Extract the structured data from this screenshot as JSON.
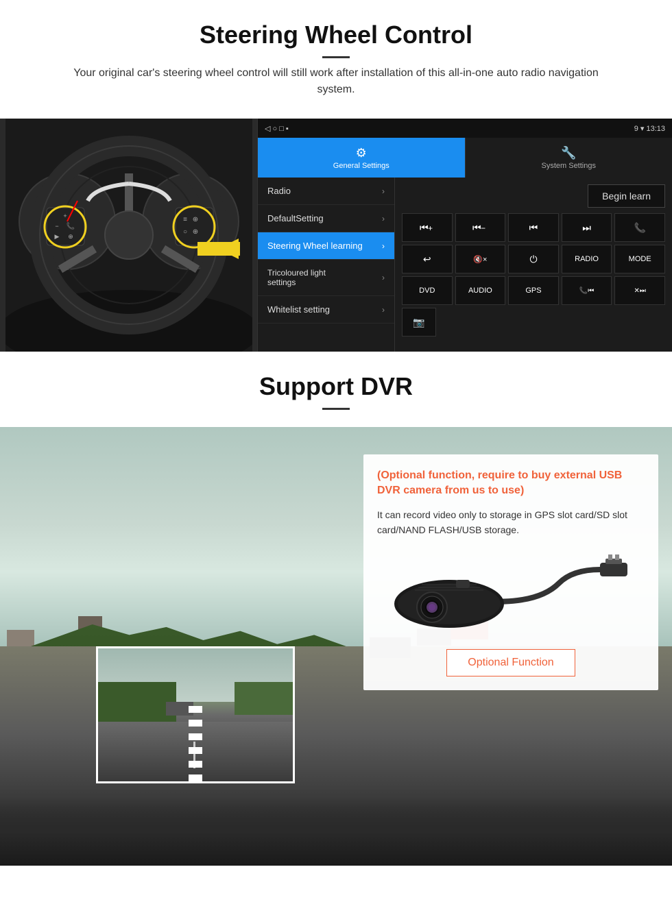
{
  "page": {
    "section1": {
      "title": "Steering Wheel Control",
      "subtitle": "Your original car's steering wheel control will still work after installation of this all-in-one auto radio navigation system.",
      "divider": "—"
    },
    "android_ui": {
      "status_bar": {
        "left_icons": "◁  ○  □  ▪",
        "right_text": "9 ▾ 13:13"
      },
      "tab_general": {
        "icon": "⚙",
        "label": "General Settings"
      },
      "tab_system": {
        "icon": "🔧",
        "label": "System Settings"
      },
      "menu_items": [
        {
          "label": "Radio",
          "active": false
        },
        {
          "label": "DefaultSetting",
          "active": false
        },
        {
          "label": "Steering Wheel learning",
          "active": true
        },
        {
          "label": "Tricoloured light settings",
          "active": false
        },
        {
          "label": "Whitelist setting",
          "active": false
        }
      ],
      "begin_learn": "Begin learn",
      "control_buttons": {
        "row1": [
          "⏮+",
          "⏮−",
          "⏮⏮",
          "⏭⏭",
          "📞"
        ],
        "row2": [
          "↩",
          "🔇×",
          "⏻",
          "RADIO",
          "MODE"
        ],
        "row3": [
          "DVD",
          "AUDIO",
          "GPS",
          "📞⏮",
          "✕⏭"
        ],
        "row4": [
          "📷"
        ]
      }
    },
    "section2": {
      "title": "Support DVR",
      "divider": "—",
      "optional_note": "(Optional function, require to buy external USB DVR camera from us to use)",
      "description": "It can record video only to storage in GPS slot card/SD slot card/NAND FLASH/USB storage.",
      "optional_button": "Optional Function"
    }
  }
}
